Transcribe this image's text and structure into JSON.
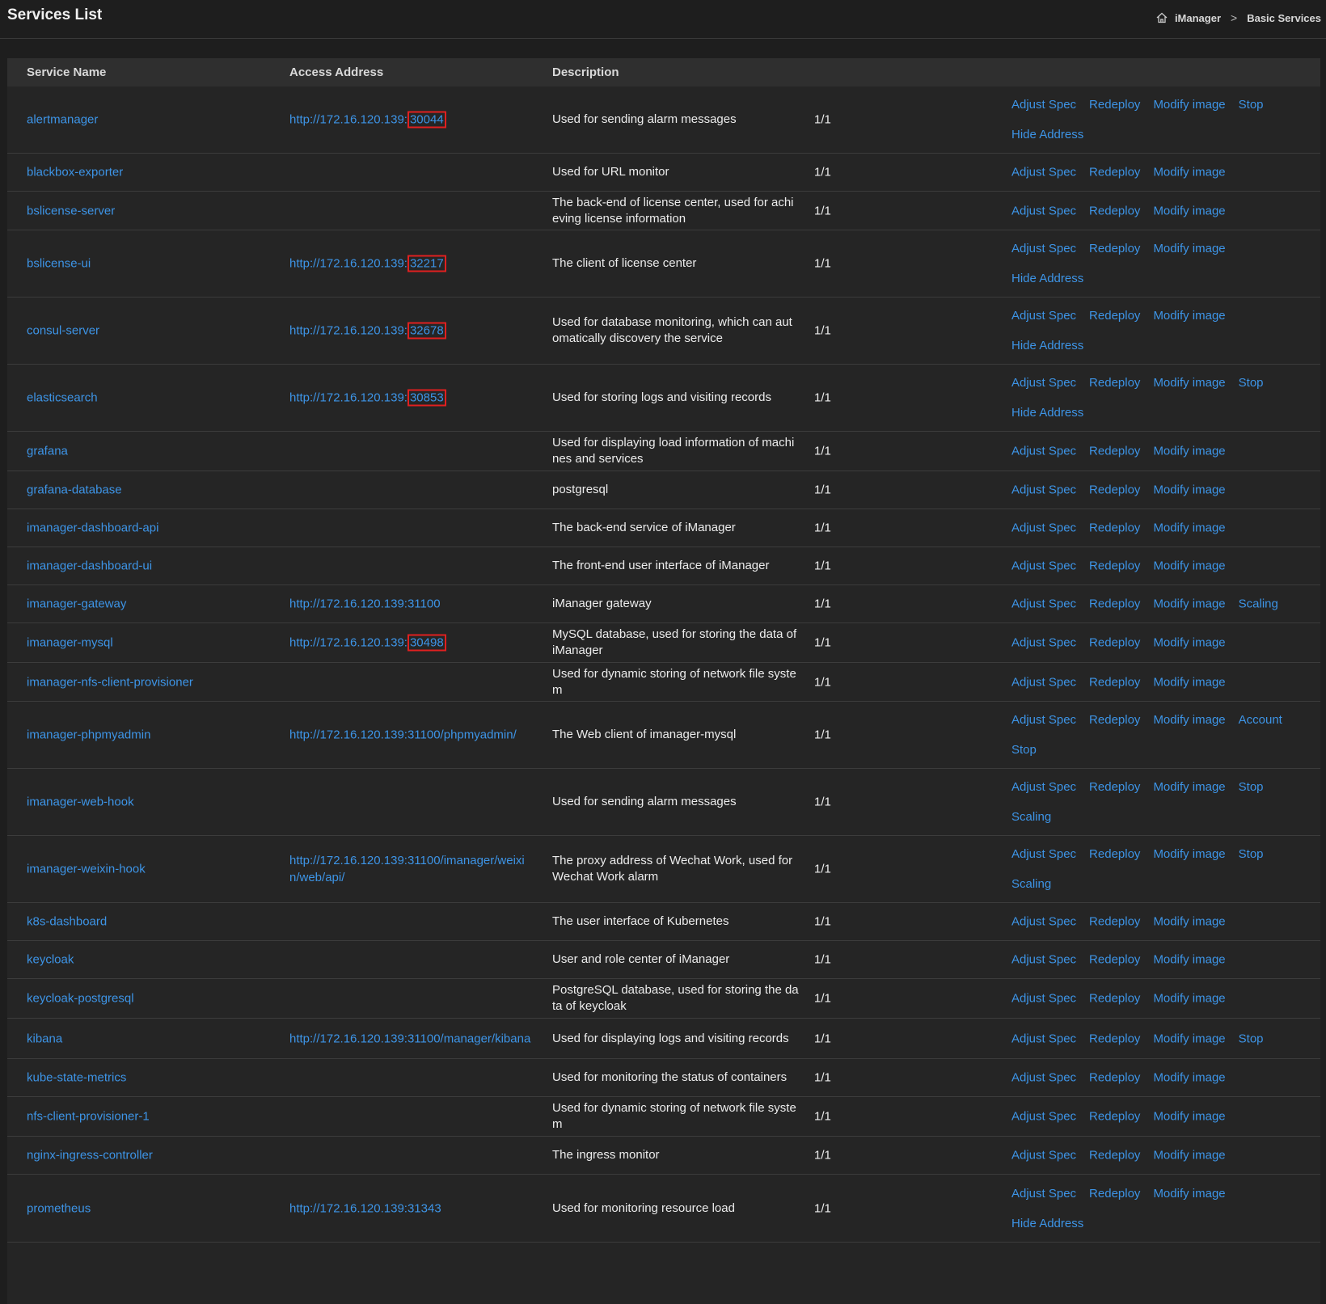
{
  "header": {
    "title": "Services List",
    "breadcrumb": [
      "iManager",
      "Basic Services"
    ]
  },
  "columns": [
    "Service Name",
    "Access Address",
    "Description"
  ],
  "rows": [
    {
      "name": "alertmanager",
      "addr": "http://172.16.120.139:",
      "port": "30044",
      "desc": "Used for sending alarm messages",
      "count": "1/1",
      "ops": [
        [
          "Adjust Spec",
          "Redeploy",
          "Modify image",
          "Stop"
        ],
        [
          "Hide Address"
        ]
      ]
    },
    {
      "name": "blackbox-exporter",
      "addr": "",
      "port": "",
      "desc": "Used for URL monitor",
      "count": "1/1",
      "ops": [
        [
          "Adjust Spec",
          "Redeploy",
          "Modify image"
        ]
      ]
    },
    {
      "name": "bslicense-server",
      "addr": "",
      "port": "",
      "desc": "The back-end of license center, used for achieving license information",
      "count": "1/1",
      "ops": [
        [
          "Adjust Spec",
          "Redeploy",
          "Modify image"
        ]
      ]
    },
    {
      "name": "bslicense-ui",
      "addr": "http://172.16.120.139:",
      "port": "32217",
      "desc": "The client of license center",
      "count": "1/1",
      "ops": [
        [
          "Adjust Spec",
          "Redeploy",
          "Modify image"
        ],
        [
          "Hide Address"
        ]
      ]
    },
    {
      "name": "consul-server",
      "addr": "http://172.16.120.139:",
      "port": "32678",
      "desc": "Used for database monitoring, which can automatically discovery the service",
      "count": "1/1",
      "ops": [
        [
          "Adjust Spec",
          "Redeploy",
          "Modify image"
        ],
        [
          "Hide Address"
        ]
      ]
    },
    {
      "name": "elasticsearch",
      "addr": "http://172.16.120.139:",
      "port": "30853",
      "desc": "Used for storing logs and visiting records",
      "count": "1/1",
      "ops": [
        [
          "Adjust Spec",
          "Redeploy",
          "Modify image",
          "Stop"
        ],
        [
          "Hide Address"
        ]
      ]
    },
    {
      "name": "grafana",
      "addr": "",
      "port": "",
      "desc": "Used for displaying load information of machines and services",
      "count": "1/1",
      "ops": [
        [
          "Adjust Spec",
          "Redeploy",
          "Modify image"
        ]
      ]
    },
    {
      "name": "grafana-database",
      "addr": "",
      "port": "",
      "desc": "postgresql",
      "count": "1/1",
      "ops": [
        [
          "Adjust Spec",
          "Redeploy",
          "Modify image"
        ]
      ]
    },
    {
      "name": "imanager-dashboard-api",
      "addr": "",
      "port": "",
      "desc": "The back-end service of iManager",
      "count": "1/1",
      "ops": [
        [
          "Adjust Spec",
          "Redeploy",
          "Modify image"
        ]
      ]
    },
    {
      "name": "imanager-dashboard-ui",
      "addr": "",
      "port": "",
      "desc": "The front-end user interface of iManager",
      "count": "1/1",
      "ops": [
        [
          "Adjust Spec",
          "Redeploy",
          "Modify image"
        ]
      ]
    },
    {
      "name": "imanager-gateway",
      "addr": "http://172.16.120.139:31100",
      "port": "",
      "desc": "iManager gateway",
      "count": "1/1",
      "ops": [
        [
          "Adjust Spec",
          "Redeploy",
          "Modify image",
          "Scaling"
        ]
      ]
    },
    {
      "name": "imanager-mysql",
      "addr": "http://172.16.120.139:",
      "port": "30498",
      "desc": "MySQL database, used for storing the data of iManager",
      "count": "1/1",
      "ops": [
        [
          "Adjust Spec",
          "Redeploy",
          "Modify image"
        ]
      ]
    },
    {
      "name": "imanager-nfs-client-provisioner",
      "addr": "",
      "port": "",
      "desc": "Used for dynamic storing of network file system",
      "count": "1/1",
      "ops": [
        [
          "Adjust Spec",
          "Redeploy",
          "Modify image"
        ]
      ]
    },
    {
      "name": "imanager-phpmyadmin",
      "addr": "http://172.16.120.139:31100/phpmyadmin/",
      "port": "",
      "desc": "The Web client of imanager-mysql",
      "count": "1/1",
      "ops": [
        [
          "Adjust Spec",
          "Redeploy",
          "Modify image",
          "Account"
        ],
        [
          "Stop"
        ]
      ]
    },
    {
      "name": "imanager-web-hook",
      "addr": "",
      "port": "",
      "desc": "Used for sending alarm messages",
      "count": "1/1",
      "ops": [
        [
          "Adjust Spec",
          "Redeploy",
          "Modify image",
          "Stop"
        ],
        [
          "Scaling"
        ]
      ]
    },
    {
      "name": "imanager-weixin-hook",
      "addr": "http://172.16.120.139:31100/imanager/weixin/web/api/",
      "port": "",
      "desc": "The proxy address of Wechat Work, used for Wechat Work alarm",
      "count": "1/1",
      "ops": [
        [
          "Adjust Spec",
          "Redeploy",
          "Modify image",
          "Stop"
        ],
        [
          "Scaling"
        ]
      ]
    },
    {
      "name": "k8s-dashboard",
      "addr": "",
      "port": "",
      "desc": "The user interface of Kubernetes",
      "count": "1/1",
      "ops": [
        [
          "Adjust Spec",
          "Redeploy",
          "Modify image"
        ]
      ]
    },
    {
      "name": "keycloak",
      "addr": "",
      "port": "",
      "desc": "User and role center of iManager",
      "count": "1/1",
      "ops": [
        [
          "Adjust Spec",
          "Redeploy",
          "Modify image"
        ]
      ]
    },
    {
      "name": "keycloak-postgresql",
      "addr": "",
      "port": "",
      "desc": "PostgreSQL database, used for storing the data of keycloak",
      "count": "1/1",
      "ops": [
        [
          "Adjust Spec",
          "Redeploy",
          "Modify image"
        ]
      ]
    },
    {
      "name": "kibana",
      "addr": "http://172.16.120.139:31100/manager/kibana",
      "port": "",
      "desc": "Used for displaying logs and visiting records",
      "count": "1/1",
      "ops": [
        [
          "Adjust Spec",
          "Redeploy",
          "Modify image",
          "Stop"
        ]
      ]
    },
    {
      "name": "kube-state-metrics",
      "addr": "",
      "port": "",
      "desc": "Used for monitoring the status of containers",
      "count": "1/1",
      "ops": [
        [
          "Adjust Spec",
          "Redeploy",
          "Modify image"
        ]
      ]
    },
    {
      "name": "nfs-client-provisioner-1",
      "addr": "",
      "port": "",
      "desc": "Used for dynamic storing of network file system",
      "count": "1/1",
      "ops": [
        [
          "Adjust Spec",
          "Redeploy",
          "Modify image"
        ]
      ]
    },
    {
      "name": "nginx-ingress-controller",
      "addr": "",
      "port": "",
      "desc": "The ingress monitor",
      "count": "1/1",
      "ops": [
        [
          "Adjust Spec",
          "Redeploy",
          "Modify image"
        ]
      ]
    },
    {
      "name": "prometheus",
      "addr": "http://172.16.120.139:31343",
      "port": "",
      "desc": "Used for monitoring resource load",
      "count": "1/1",
      "ops": [
        [
          "Adjust Spec",
          "Redeploy",
          "Modify image"
        ],
        [
          "Hide Address"
        ]
      ]
    }
  ]
}
